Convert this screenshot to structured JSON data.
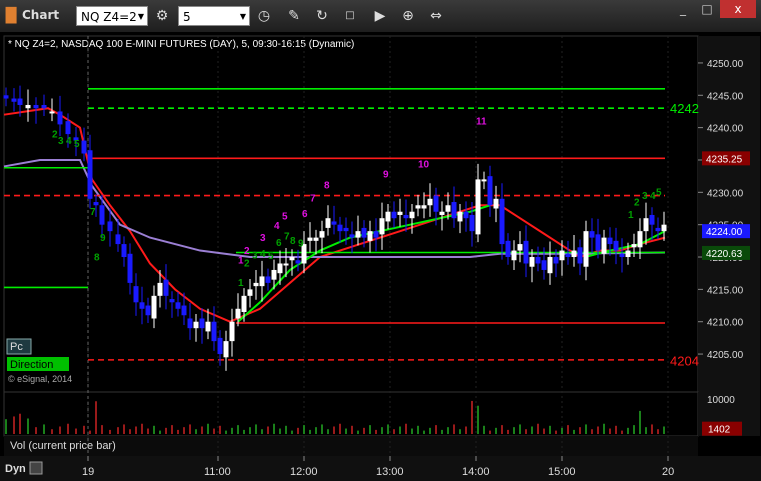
{
  "titlebar": {
    "app_title": "Chart",
    "symbol": "NQ Z4=2",
    "interval": "5",
    "window_buttons": [
      "_",
      "□",
      "x"
    ]
  },
  "chart_header": "* NQ Z4=2, NASDAQ 100 E-MINI FUTURES (DAY), 5, 09:30-16:15 (Dynamic)",
  "watermark": "© eSignal, 2014",
  "pc_tag": "Pc",
  "direction_tag": "Direction",
  "volume_panel_label": "Vol (current price bar)",
  "dyn_label": "Dyn",
  "colors": {
    "up": "#ffffff",
    "down": "#1a1aff",
    "red_line": "#ff1a1a",
    "green_line": "#00ee00",
    "ma_purple": "#9b7fd4",
    "count_magenta": "#e010e0",
    "count_green": "#00a000"
  },
  "chart_data": {
    "type": "candlestick",
    "y_ticks": [
      "4250.00",
      "4245.00",
      "4240.00",
      "4235.00",
      "4230.00",
      "4225.00",
      "4220.00",
      "4215.00",
      "4210.00",
      "4205.00"
    ],
    "ylim": [
      4203,
      4252
    ],
    "x_ticks": [
      "19",
      "11:00",
      "12:00",
      "13:00",
      "14:00",
      "15:00",
      "20"
    ],
    "price_labels": [
      {
        "text": "4242",
        "value": 4243,
        "color": "#00ee00"
      },
      {
        "text": "4235.25",
        "value": 4235.25,
        "color": "#ff1a1a"
      },
      {
        "text": "4224.00",
        "value": 4224.0,
        "color": "#ffffff"
      },
      {
        "text": "4220.63",
        "value": 4220.63,
        "color": "#00ee00"
      },
      {
        "text": "4204",
        "value": 4204,
        "color": "#ff1a1a"
      }
    ],
    "levels": [
      {
        "value": 4246.0,
        "color": "#00ee00",
        "dashed": false,
        "from": 88
      },
      {
        "value": 4243.0,
        "color": "#00ee00",
        "dashed": true,
        "from": 88
      },
      {
        "value": 4235.25,
        "color": "#ff1a1a",
        "dashed": false,
        "from": 88
      },
      {
        "value": 4229.5,
        "color": "#ff1a1a",
        "dashed": true,
        "from": 4
      },
      {
        "value": 4220.7,
        "color": "#00ee00",
        "dashed": false,
        "from": 236
      },
      {
        "value": 4209.8,
        "color": "#ff1a1a",
        "dashed": false,
        "from": 236
      },
      {
        "value": 4204.1,
        "color": "#ff1a1a",
        "dashed": true,
        "from": 88
      }
    ],
    "volume_ticks": [
      "10000",
      "1402"
    ],
    "volume_max": 10000,
    "volume_last": 1402,
    "count_labels": [
      {
        "text": "2",
        "color": "#00a000",
        "value": 4238.5
      },
      {
        "text": "3",
        "color": "#00a000",
        "value": 4237.5
      },
      {
        "text": "4",
        "color": "#00a000",
        "value": 4237.5
      },
      {
        "text": "5",
        "color": "#00a000",
        "value": 4237.0
      },
      {
        "text": "7",
        "color": "#00a000",
        "value": 4226.5
      },
      {
        "text": "9",
        "color": "#00a000",
        "value": 4222.5
      },
      {
        "text": "8",
        "color": "#00a000",
        "value": 4219.5
      },
      {
        "text": "1",
        "color": "#e010e0",
        "value": 4219.0
      },
      {
        "text": "2",
        "color": "#e010e0",
        "value": 4220.5
      },
      {
        "text": "3",
        "color": "#e010e0",
        "value": 4222.5
      },
      {
        "text": "4",
        "color": "#e010e0",
        "value": 4224.3
      },
      {
        "text": "5",
        "color": "#e010e0",
        "value": 4225.8
      },
      {
        "text": "6",
        "color": "#e010e0",
        "value": 4226.2
      },
      {
        "text": "7",
        "color": "#e010e0",
        "value": 4228.6
      },
      {
        "text": "8",
        "color": "#e010e0",
        "value": 4230.6
      },
      {
        "text": "9",
        "color": "#e010e0",
        "value": 4232.3
      },
      {
        "text": "10",
        "color": "#e010e0",
        "value": 4233.8
      },
      {
        "text": "11",
        "color": "#e010e0",
        "value": 4240.5
      },
      {
        "text": "1",
        "color": "#00a000",
        "value": 4215.5
      },
      {
        "text": "2",
        "color": "#00a000",
        "value": 4218.5
      },
      {
        "text": "3",
        "color": "#00a000",
        "value": 4219.8
      },
      {
        "text": "4",
        "color": "#00a000",
        "value": 4220.0
      },
      {
        "text": "5",
        "color": "#00a000",
        "value": 4219.7
      },
      {
        "text": "6",
        "color": "#00a000",
        "value": 4221.7
      },
      {
        "text": "7",
        "color": "#00a000",
        "value": 4222.7
      },
      {
        "text": "8",
        "color": "#00a000",
        "value": 4222.0
      },
      {
        "text": "9",
        "color": "#00a000",
        "value": 4221.6
      },
      {
        "text": "1",
        "color": "#00a000",
        "value": 4226.0
      },
      {
        "text": "2",
        "color": "#00a000",
        "value": 4228.0
      },
      {
        "text": "3",
        "color": "#00a000",
        "value": 4229.0
      },
      {
        "text": "4",
        "color": "#00a000",
        "value": 4229.0
      },
      {
        "text": "5",
        "color": "#00a000",
        "value": 4229.5
      }
    ]
  }
}
